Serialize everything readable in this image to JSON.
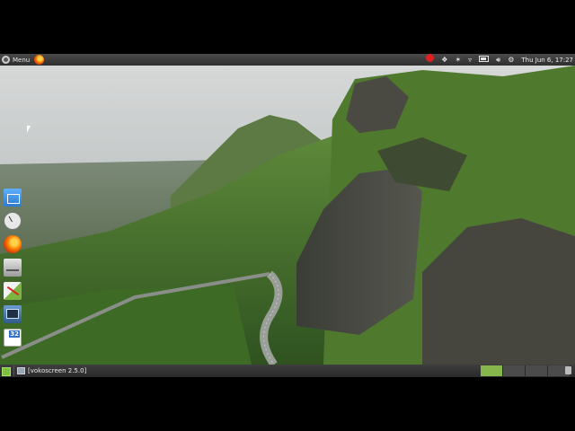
{
  "top_panel": {
    "menu_label": "Menu",
    "launcher_icon": "firefox-icon",
    "tray_icons": [
      "record-icon",
      "dropbox-icon",
      "bluetooth-icon",
      "wifi-icon",
      "battery-icon",
      "volume-icon"
    ],
    "clock": "Thu Jun  6, 17:27",
    "settings_icon": "settings-icon"
  },
  "dock": {
    "items": [
      {
        "icon": "file-manager-icon"
      },
      {
        "icon": "clock-icon"
      },
      {
        "icon": "firefox-icon"
      },
      {
        "icon": "drive-icon"
      },
      {
        "icon": "text-editor-icon"
      },
      {
        "icon": "system-monitor-icon"
      },
      {
        "icon": "calculator-icon",
        "badge": "32"
      }
    ]
  },
  "taskbar": {
    "show_desktop_icon": "show-desktop-icon",
    "task_label": "[vokoscreen 2.5.0]",
    "workspaces_active": 1,
    "workspace_count": 4
  },
  "colors": {
    "panel": "#3a3a3a",
    "accent": "#86b64c",
    "record": "#e02020"
  }
}
